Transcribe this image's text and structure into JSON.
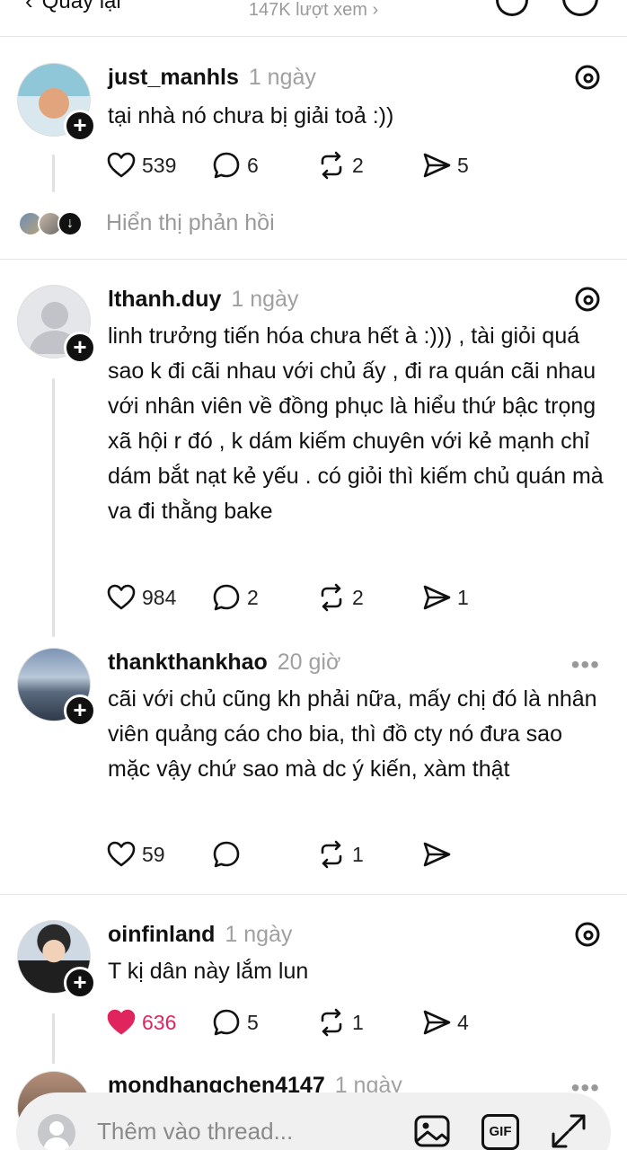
{
  "topbar": {
    "back_label": "Quay lại",
    "views": "147K lượt xem"
  },
  "posts": [
    {
      "username": "just_manhls",
      "time": "1 ngày",
      "text": "tại nhà nó chưa bị giải toả :))",
      "likes": "539",
      "comments": "6",
      "reposts": "2",
      "shares": "5",
      "liked": false
    },
    {
      "username": "lthanh.duy",
      "time": "1 ngày",
      "text": "linh trưởng tiến hóa chưa hết à :))) , tài giỏi quá sao k đi cãi nhau với chủ ấy , đi ra quán cãi nhau với nhân viên về đồng phục là hiểu thứ bậc trọng xã hội r đó , k dám kiếm chuyên  với kẻ mạnh chỉ dám bắt nạt kẻ yếu . có giỏi thì kiếm chủ quán mà va đi thằng bake",
      "likes": "984",
      "comments": "2",
      "reposts": "2",
      "shares": "1",
      "liked": false
    },
    {
      "username": "thankthankhao",
      "time": "20 giờ",
      "text": "cãi với chủ cũng kh phải nữa, mấy chị đó là nhân viên quảng cáo cho bia, thì đồ cty nó đưa sao mặc vậy chứ sao mà dc ý kiến, xàm thật",
      "likes": "59",
      "comments": "",
      "reposts": "1",
      "shares": "",
      "liked": false
    },
    {
      "username": "oinfinland",
      "time": "1 ngày",
      "text": "T kị dân này lắm lun",
      "likes": "636",
      "comments": "5",
      "reposts": "1",
      "shares": "4",
      "liked": true
    },
    {
      "username": "mondhangchen4147",
      "time": "1 ngày"
    }
  ],
  "replies_label": "Hiển thị phản hồi",
  "composer": {
    "placeholder": "Thêm vào thread..."
  },
  "colors": {
    "liked": "#e0245e",
    "muted": "#9a9a9a"
  }
}
